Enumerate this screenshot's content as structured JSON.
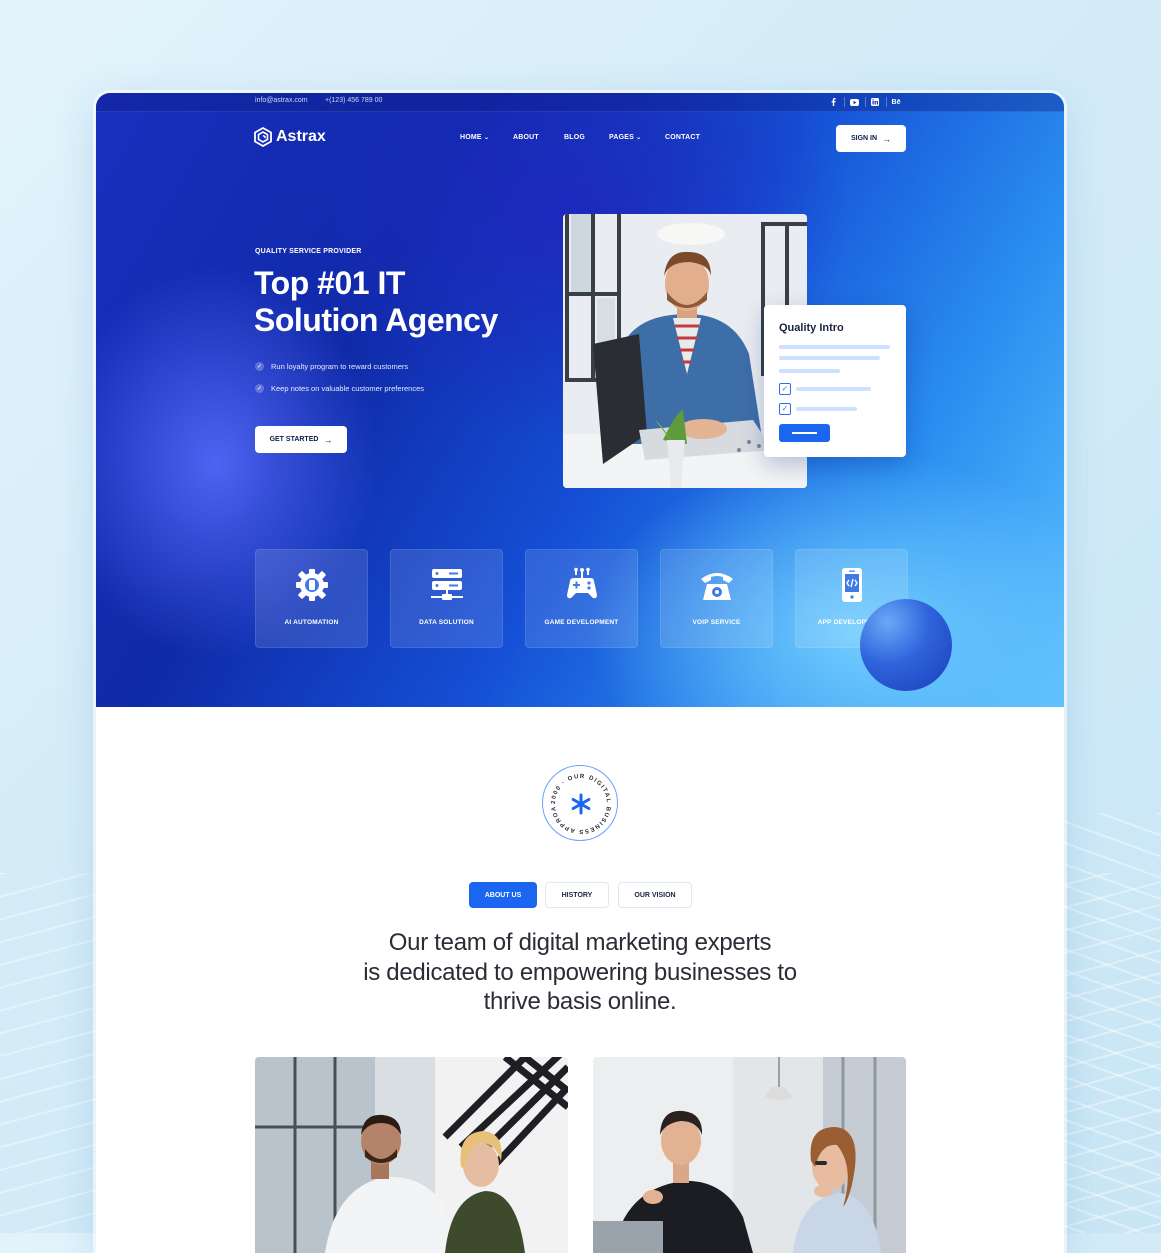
{
  "topbar": {
    "email": "info@astrax.com",
    "phone": "+(123) 456 789 00",
    "social": [
      "facebook-icon",
      "youtube-icon",
      "linkedin-icon",
      "behance-icon"
    ],
    "behance_label": "Bē"
  },
  "nav": {
    "brand": "Astrax",
    "items": [
      {
        "label": "HOME",
        "dropdown": true
      },
      {
        "label": "ABOUT",
        "dropdown": false
      },
      {
        "label": "BLOG",
        "dropdown": false
      },
      {
        "label": "PAGES",
        "dropdown": true
      },
      {
        "label": "CONTACT",
        "dropdown": false
      }
    ],
    "signin_label": "SIGN IN"
  },
  "hero": {
    "eyebrow": "QUALITY SERVICE PROVIDER",
    "headline_line1": "Top #01 IT",
    "headline_line2": "Solution Agency",
    "features": [
      "Run loyalty program to reward customers",
      "Keep notes on valuable customer preferences"
    ],
    "cta_label": "GET STARTED"
  },
  "quality_card": {
    "title": "Quality Intro"
  },
  "services": [
    {
      "label": "AI AUTOMATION",
      "icon": "gear-chip-icon"
    },
    {
      "label": "DATA SOLUTION",
      "icon": "server-icon"
    },
    {
      "label": "GAME DEVELOPMENT",
      "icon": "gamepad-icon"
    },
    {
      "label": "VOIP SERVICE",
      "icon": "telephone-icon"
    },
    {
      "label": "APP DEVELOPMENT",
      "icon": "mobile-code-icon"
    }
  ],
  "badge": {
    "ring_text": "2000 · OUR DIGITAL BUSINESS APPROACH ·"
  },
  "about_tabs": [
    {
      "label": "ABOUT US",
      "active": true
    },
    {
      "label": "HISTORY",
      "active": false
    },
    {
      "label": "OUR VISION",
      "active": false
    }
  ],
  "mission": {
    "line1": "Our team of digital marketing experts",
    "line2": "is dedicated to empowering businesses to",
    "line3": "thrive basis online."
  },
  "colors": {
    "accent": "#1a66f0",
    "hero_dark": "#0f2aa8",
    "hero_light": "#5cc0ff"
  }
}
